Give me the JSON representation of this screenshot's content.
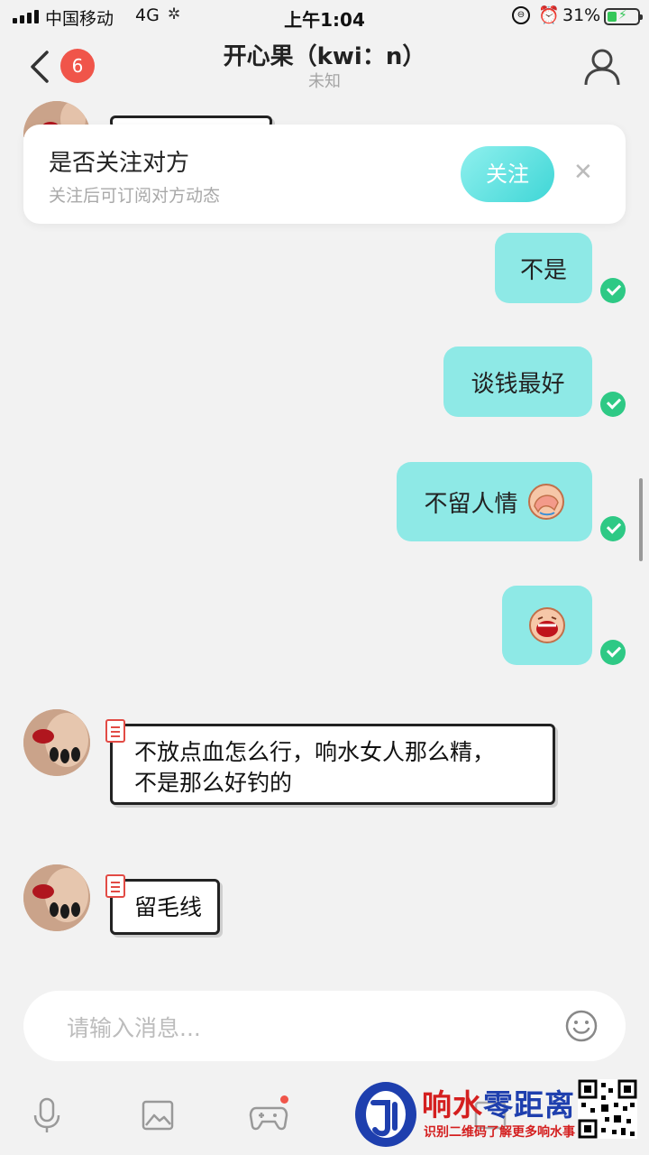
{
  "status_bar": {
    "carrier": "中国移动",
    "network": "4G",
    "time": "上午1:04",
    "battery": "31%",
    "battery_level": 0.31
  },
  "header": {
    "unread_count": "6",
    "title": "开心果（kwi：n）",
    "subtitle": "未知"
  },
  "follow_card": {
    "title": "是否关注对方",
    "description": "关注后可订阅对方动态",
    "button_label": "关注"
  },
  "messages": [
    {
      "side": "out",
      "text": "不是"
    },
    {
      "side": "out",
      "text": "谈钱最好"
    },
    {
      "side": "out",
      "text": "不留人情"
    },
    {
      "side": "out",
      "text": ""
    },
    {
      "side": "in",
      "lines": [
        "不放点血怎么行，响水女人那么精，",
        "不是那么好钓的"
      ]
    },
    {
      "side": "in",
      "lines": [
        "留毛线"
      ]
    }
  ],
  "input": {
    "placeholder": "请输入消息..."
  },
  "watermark": {
    "title_red": "响水",
    "title_blue": "零距离",
    "subtitle": "识别二维码了解更多响水事"
  },
  "colors": {
    "outgoing_bubble": "#8ee9e6",
    "accent": "#3fd6d6",
    "badge": "#f0554a",
    "check": "#2ec985"
  }
}
